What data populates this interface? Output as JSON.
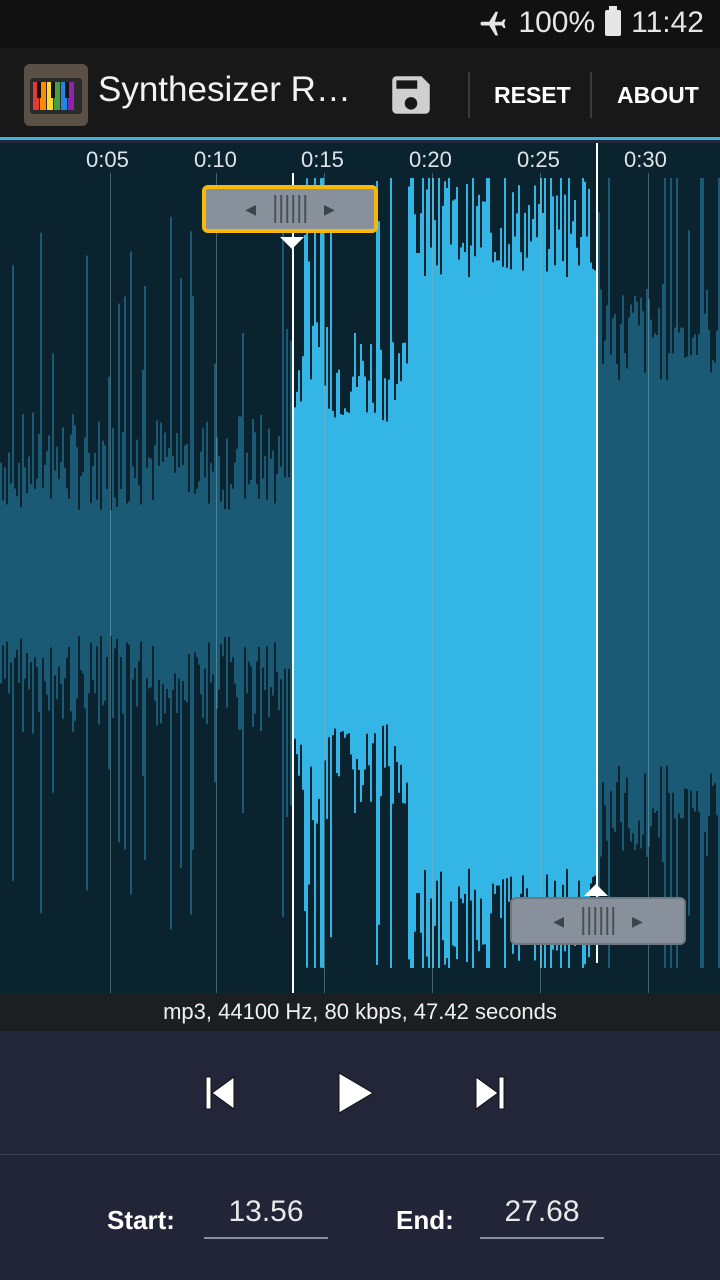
{
  "status_bar": {
    "battery": "100%",
    "time": "11:42",
    "icons": [
      "airplane-mode-icon",
      "battery-icon"
    ]
  },
  "action_bar": {
    "title": "Synthesizer R…",
    "save_icon": "save-icon",
    "reset_label": "RESET",
    "about_label": "ABOUT"
  },
  "timeline": {
    "ticks": [
      "0:05",
      "0:10",
      "0:15",
      "0:20",
      "0:25",
      "0:30"
    ],
    "selection": {
      "start_seconds": 13.56,
      "end_seconds": 27.68
    },
    "total_seconds": 47.42
  },
  "file_info": "mp3, 44100 Hz, 80 kbps, 47.42 seconds",
  "controls": {
    "icons": [
      "skip-previous-icon",
      "play-icon",
      "skip-next-icon"
    ]
  },
  "footer": {
    "start_label": "Start:",
    "start_value": "13.56",
    "end_label": "End:",
    "end_value": "27.68"
  },
  "colors": {
    "accent": "#33b5e5",
    "waveform_dim": "#1a5a75",
    "waveform_selected": "#33b5e5",
    "handle_focus": "#f5b80b"
  }
}
